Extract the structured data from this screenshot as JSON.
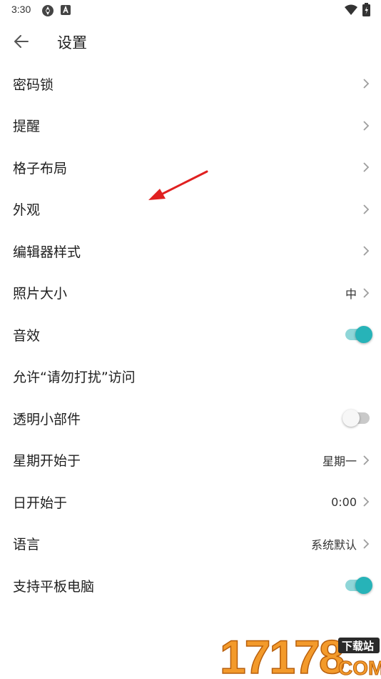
{
  "status_bar": {
    "time": "3:30",
    "left_icons": [
      "sync-icon",
      "a-badge-icon"
    ],
    "right_icons": [
      "wifi-icon",
      "battery-icon"
    ]
  },
  "app_bar": {
    "title": "设置",
    "back_icon": "arrow-left-icon"
  },
  "settings": {
    "items": [
      {
        "label": "密码锁",
        "value": "",
        "control": "chevron"
      },
      {
        "label": "提醒",
        "value": "",
        "control": "chevron"
      },
      {
        "label": "格子布局",
        "value": "",
        "control": "chevron"
      },
      {
        "label": "外观",
        "value": "",
        "control": "chevron"
      },
      {
        "label": "编辑器样式",
        "value": "",
        "control": "chevron"
      },
      {
        "label": "照片大小",
        "value": "中",
        "control": "chevron"
      },
      {
        "label": "音效",
        "value": "",
        "control": "toggle",
        "checked": true
      },
      {
        "label": "允许“请勿打扰”访问",
        "value": "",
        "control": "none"
      },
      {
        "label": "透明小部件",
        "value": "",
        "control": "toggle",
        "checked": false
      },
      {
        "label": "星期开始于",
        "value": "星期一",
        "control": "chevron"
      },
      {
        "label": "日开始于",
        "value": "0:00",
        "control": "chevron"
      },
      {
        "label": "语言",
        "value": "系统默认",
        "control": "chevron"
      },
      {
        "label": "支持平板电脑",
        "value": "",
        "control": "toggle",
        "checked": true
      }
    ]
  },
  "watermark": {
    "digits": "17178",
    "badge": "下载站",
    "suffix": "COM"
  },
  "colors": {
    "accent": "#27b3b8",
    "toggle_track_on": "#8fd6d8",
    "toggle_track_off": "#c9c9c9",
    "annotation_arrow": "#e02020",
    "watermark_orange": "#f39a2b"
  }
}
